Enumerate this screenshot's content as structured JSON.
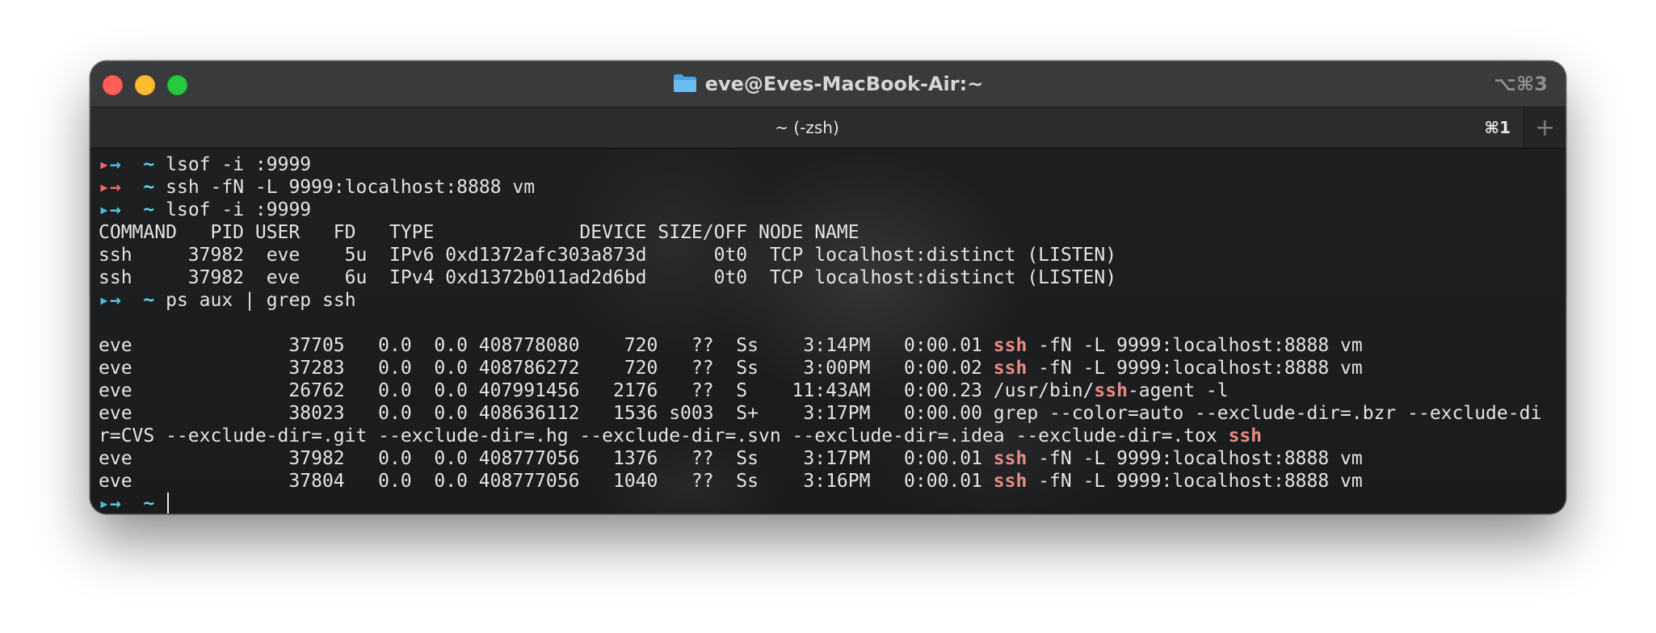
{
  "window": {
    "title": "eve@Eves-MacBook-Air:~",
    "title_icon": "folder-icon",
    "shortcut": "⌥⌘3"
  },
  "tab": {
    "label": "~ (-zsh)",
    "shortcut": "⌘1",
    "new_tab_icon": "+"
  },
  "colors": {
    "prompt_error_arrow": "#f06a6a",
    "prompt_ok_arrow": "#4fb8d8",
    "cwd": "#5fd7e8",
    "match_highlight": "#e88b84"
  },
  "terminal": {
    "prompt_arrow": "→",
    "cwd": "~",
    "cmd1": "lsof -i :9999",
    "cmd2": "ssh -fN -L 9999:localhost:8888 vm",
    "cmd3": "lsof -i :9999",
    "lsof_header": "COMMAND   PID USER   FD   TYPE             DEVICE SIZE/OFF NODE NAME",
    "lsof_row1": "ssh     37982  eve    5u  IPv6 0xd1372afc303a873d      0t0  TCP localhost:distinct (LISTEN)",
    "lsof_row2": "ssh     37982  eve    6u  IPv4 0xd1372b011ad2d6bd      0t0  TCP localhost:distinct (LISTEN)",
    "cmd4": "ps aux | grep ssh",
    "ps1_pre": "eve              37705   0.0  0.0 408778080    720   ??  Ss    3:14PM   0:00.01 ",
    "ps1_match": "ssh",
    "ps1_post": " -fN -L 9999:localhost:8888 vm",
    "ps2_pre": "eve              37283   0.0  0.0 408786272    720   ??  Ss    3:00PM   0:00.02 ",
    "ps2_match": "ssh",
    "ps2_post": " -fN -L 9999:localhost:8888 vm",
    "ps3_pre": "eve              26762   0.0  0.0 407991456   2176   ??  S    11:43AM   0:00.23 /usr/bin/",
    "ps3_match": "ssh",
    "ps3_post": "-agent -l",
    "ps4": "eve              38023   0.0  0.0 408636112   1536 s003  S+    3:17PM   0:00.00 grep --color=auto --exclude-dir=.bzr --exclude-di",
    "ps4_wrap_pre": "r=CVS --exclude-dir=.git --exclude-dir=.hg --exclude-dir=.svn --exclude-dir=.idea --exclude-dir=.tox ",
    "ps4_wrap_match": "ssh",
    "ps5_pre": "eve              37982   0.0  0.0 408777056   1376   ??  Ss    3:17PM   0:00.01 ",
    "ps5_match": "ssh",
    "ps5_post": " -fN -L 9999:localhost:8888 vm",
    "ps6_pre": "eve              37804   0.0  0.0 408777056   1040   ??  Ss    3:16PM   0:00.01 ",
    "ps6_match": "ssh",
    "ps6_post": " -fN -L 9999:localhost:8888 vm"
  }
}
